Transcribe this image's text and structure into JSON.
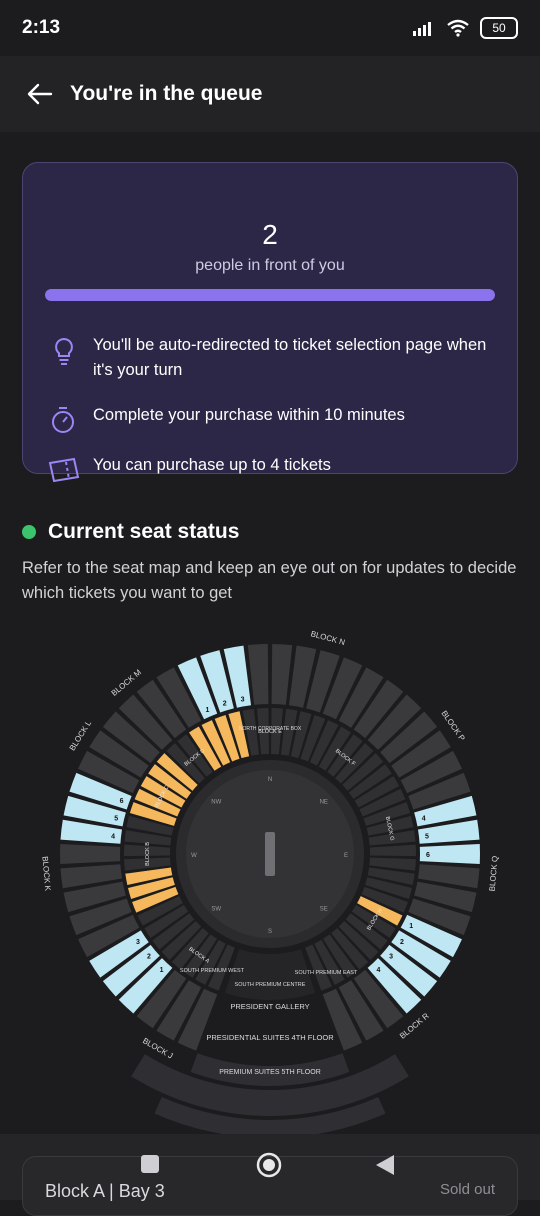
{
  "status_bar": {
    "time": "2:13",
    "battery": "50"
  },
  "header": {
    "title": "You're in the queue",
    "back_icon": "arrow-left-icon"
  },
  "queue": {
    "count": "2",
    "caption": "people in front of you",
    "progress": 1.0,
    "info": [
      {
        "icon": "lightbulb-icon",
        "text": "You'll be auto-redirected to ticket selection page when it's your turn"
      },
      {
        "icon": "stopwatch-icon",
        "text": "Complete your purchase within 10 minutes"
      },
      {
        "icon": "ticket-icon",
        "text": "You can purchase up to 4 tickets"
      }
    ]
  },
  "seat_status": {
    "title": "Current seat status",
    "description": "Refer to the seat map and keep an eye out on for updates to decide which tickets you want to get"
  },
  "seat_map": {
    "outer_blocks": [
      "BLOCK M",
      "BLOCK N",
      "BLOCK P",
      "BLOCK Q",
      "BLOCK R",
      "BLOCK J",
      "BLOCK K",
      "BLOCK L"
    ],
    "inner_blocks": [
      "BLOCK D",
      "BLOCK E",
      "BLOCK F",
      "BLOCK G",
      "BLOCK H",
      "BLOCK A",
      "BLOCK B",
      "BLOCK C"
    ],
    "compass": [
      "N",
      "NE",
      "E",
      "SE",
      "S",
      "SW",
      "W",
      "NW"
    ],
    "stand_labels": [
      "NORTH CORPORATE BOX",
      "SOUTH PREMIUM WEST",
      "SOUTH PREMIUM CENTRE",
      "SOUTH PREMIUM EAST",
      "PRESIDENT GALLERY",
      "PRESIDENTIAL SUITES 4TH FLOOR",
      "PREMIUM SUITES 5TH FLOOR"
    ],
    "colors": {
      "available": "#bfe6f3",
      "few_left": "#f5b85c",
      "unavailable": "#3a3a3d",
      "bay_number_dark": "#111111"
    }
  },
  "selection": {
    "label": "Block A | Bay 3",
    "status": "Sold out"
  },
  "nav": {
    "square": "square-icon",
    "home": "circle-home-icon",
    "back": "triangle-back-icon"
  }
}
